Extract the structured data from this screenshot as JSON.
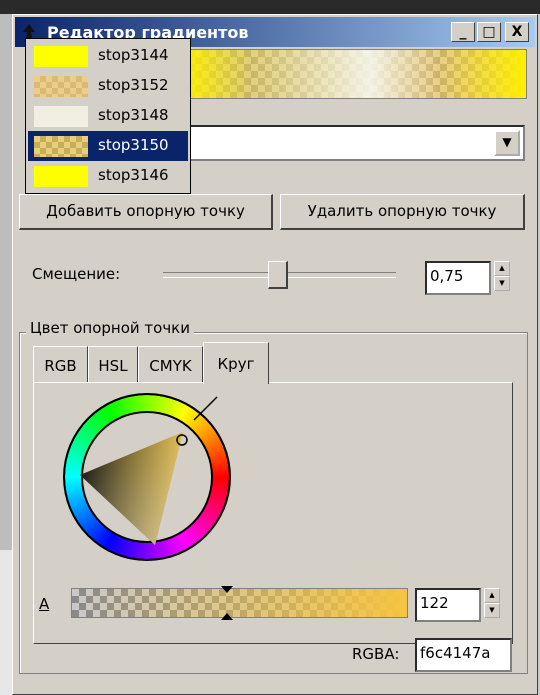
{
  "window": {
    "title": "Редактор градиентов",
    "buttons": {
      "minimize": "_",
      "maximize": "□",
      "close": "X"
    }
  },
  "buttons": {
    "add_stop": "Добавить опорную точку",
    "delete_stop": "Удалить опорную точку"
  },
  "offset": {
    "label": "Смещение:",
    "value": "0,75",
    "fraction": 0.75
  },
  "stop_color": {
    "group_label": "Цвет опорной точки",
    "tabs": [
      {
        "label": "RGB"
      },
      {
        "label": "HSL"
      },
      {
        "label": "CMYK"
      },
      {
        "label": "Круг",
        "active": true
      }
    ],
    "alpha_label": "A",
    "alpha_value": "122",
    "rgba_label": "RGBA:",
    "rgba_value": "f6c4147a"
  },
  "stops_dropdown": {
    "items": [
      {
        "label": "stop3144",
        "color": "#ffff00",
        "alpha": 1.0
      },
      {
        "label": "stop3152",
        "color": "#f6c865",
        "alpha": 0.7
      },
      {
        "label": "stop3148",
        "color": "#f0efe2",
        "alpha": 1.0
      },
      {
        "label": "stop3150",
        "color": "#f6c414",
        "alpha": 0.48,
        "selected": true
      },
      {
        "label": "stop3146",
        "color": "#ffff00",
        "alpha": 1.0
      }
    ]
  },
  "colors": {
    "title_start": "#0a246a",
    "title_end": "#a6caf0",
    "selection": "#0a246a",
    "dialog_bg": "#d4d0c8"
  }
}
